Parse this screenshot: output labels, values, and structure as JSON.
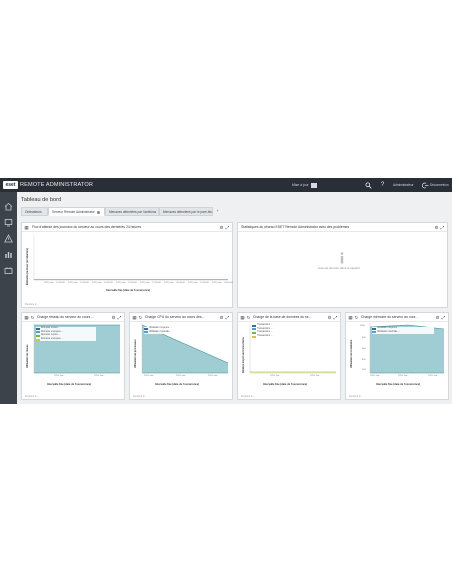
{
  "app": {
    "logo": "eset",
    "title": "REMOTE ADMINISTRATOR",
    "updater_label": "Mise à jour",
    "user_label": "Administrateur",
    "logout_label": "Déconnexion"
  },
  "page": {
    "title": "Tableau de bord"
  },
  "tabs": [
    {
      "label": "Ordinateurs",
      "active": false
    },
    {
      "label": "Serveur Remote Administrator",
      "active": true
    },
    {
      "label": "Menaces détectées par l'antivirus",
      "active": false
    },
    {
      "label": "Menaces détectées par le pare-feu",
      "active": false
    }
  ],
  "widgets": {
    "w1": {
      "title": "Flux d'attente des journaux du serveur au cours des dernières 24 heures",
      "xlabel": "Intervalle fixe (date de l'occurrence)",
      "ylabel": "Éléments journaux (en attente/s)",
      "ticks": [
        "2015-Jan-... 14:00:00",
        "2015-Jan-... 16:00:00",
        "2015-Jan-... 18:00:00",
        "2015-Jan-... 20:00:00",
        "2015-Jan-... 22:00:00",
        "2015-Jan-... 00:00:00",
        "2015-Jan-... 02:00:00",
        "2015-Jan-... 04:00:00"
      ],
      "footer": "Dernière m..."
    },
    "w2": {
      "title": "Statistiques du réseau ESET Remote Administrator avec des problèmes",
      "nodata": "Aucune donnée dans le rapport",
      "footer": ""
    },
    "w3": {
      "title": "Charge réseau du serveur au cours ...",
      "xlabel": "Intervalle fixe (date de l'occurrence)",
      "ylabel": "Utilisation du réseau",
      "legend": [
        "Données reçues ...",
        "Données envoyées ...",
        "Données reçues ...",
        "Données envoyées ..."
      ],
      "ticks": [
        "2015-Jan...",
        "2015-Jan..."
      ],
      "footer": "Dernière m..."
    },
    "w4": {
      "title": "Charge CPU du serveur au cours des...",
      "xlabel": "Intervalle fixe (date de l'occurrence)",
      "ylabel": "Utilisation du processeur",
      "legend": [
        "Utilisation moyenne ...",
        "Utilisation maximale ..."
      ],
      "ticks": [
        "2015-Jan...",
        "2015-Jan...",
        "2015-Jan..."
      ],
      "footer": "Dernière m..."
    },
    "w5": {
      "title": "Charge de la base de données du se...",
      "xlabel": "Intervalle fixe (date de l'occurrence)",
      "ylabel": "Nombre moyen de transactions",
      "legend": [
        "Transactions ...",
        "Transactions ...",
        "Transactions ...",
        "Transactions ..."
      ],
      "ticks": [
        "2015-Jan...",
        "2015-Jan..."
      ],
      "footer": "Dernière m..."
    },
    "w6": {
      "title": "Charge mémoire du serveur au cour...",
      "xlabel": "Intervalle fixe (date de l'occurrence)",
      "ylabel": "Utilisation de la mémoire",
      "legend": [
        "Utilisation moyenne ...",
        "Utilisation maximale ..."
      ],
      "ticks": [
        "2015-Jan...",
        "2015-Jan...",
        "2015-Jan..."
      ],
      "yticks": [
        "1000",
        "800",
        "600",
        "400",
        "200"
      ],
      "footer": "Dernière m..."
    }
  },
  "colors": {
    "topbar": "#2a2f36",
    "sidebar": "#3d434a",
    "area_fill": "#8fc4cc",
    "area_line": "#3f8d9a",
    "series_blue": "#2f6f9a",
    "series_green": "#7fb53f",
    "series_yellow": "#e2c23a"
  }
}
